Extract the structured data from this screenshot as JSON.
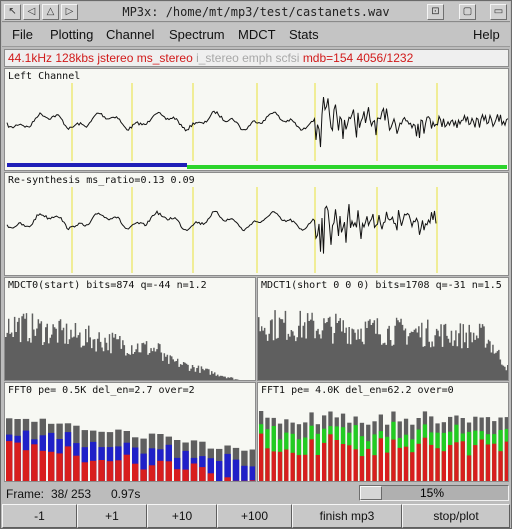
{
  "window": {
    "title": "MP3x: /home/mt/mp3/test/castanets.wav",
    "controls_left": [
      "↖",
      "◁",
      "△",
      "▷"
    ],
    "controls_right": [
      "⊡",
      "▢",
      "▭"
    ]
  },
  "menu": {
    "file": "File",
    "plotting": "Plotting",
    "channel": "Channel",
    "spectrum": "Spectrum",
    "mdct": "MDCT",
    "stats": "Stats",
    "help": "Help"
  },
  "info": {
    "active": "44.1kHz 128kbs  jstereo ms_stereo ",
    "inactive": "i_stereo emph scfsi ",
    "mdb": " mdb=154   4056/1232"
  },
  "panels": {
    "left_channel": "Left Channel",
    "resynthesis": "Re-synthesis  ms_ratio=0.13  0.09",
    "mdct0": "MDCT0(start) bits=874 q=-44 n=1.2",
    "mdct1": "MDCT1(short 0 0 0) bits=1708 q=-31 n=1.5",
    "fft0": "FFT0 pe= 0.5K del_en=2.7 over=2",
    "fft1": "FFT1 pe= 4.0K del_en=62.2 over=0"
  },
  "status": {
    "frame_label": "Frame:",
    "frame_value": "38/ 253",
    "time": "0.97s",
    "slider_value": "15%",
    "slider_fraction": 0.15
  },
  "buttons": {
    "minus1": "-1",
    "plus1": "+1",
    "plus10": "+10",
    "plus100": "+100",
    "finish": "finish mp3",
    "stop": "stop/plot"
  },
  "colors": {
    "info_red": "#d11a1a",
    "info_grey": "#a8a8a8",
    "marker_yellow": "#e8e23a",
    "blue_bar": "#1f1fb8",
    "green_bar": "#2bd42b",
    "mdct_fill": "#5f5f5f",
    "fft_grey": "#5f5f5f",
    "fft_red": "#d81e1e",
    "fft_blue": "#2020c8",
    "fft_green": "#22cc22"
  }
}
